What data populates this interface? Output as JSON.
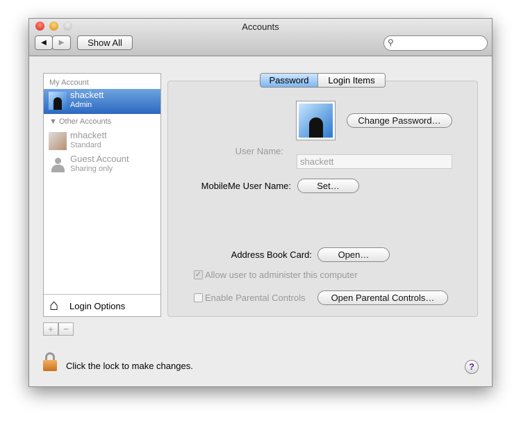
{
  "window": {
    "title": "Accounts"
  },
  "toolbar": {
    "show_all": "Show All",
    "back": "◀",
    "forward": "▶",
    "search_placeholder": ""
  },
  "sidebar": {
    "my_account_header": "My Account",
    "other_accounts_header": "Other Accounts",
    "accounts": [
      {
        "name": "shackett",
        "role": "Admin"
      },
      {
        "name": "mhackett",
        "role": "Standard"
      },
      {
        "name": "Guest Account",
        "role": "Sharing only"
      }
    ],
    "login_options": "Login Options",
    "add": "+",
    "remove": "−"
  },
  "tabs": [
    {
      "label": "Password",
      "selected": true
    },
    {
      "label": "Login Items",
      "selected": false
    }
  ],
  "password": {
    "change_password": "Change Password…",
    "user_name_label": "User Name:",
    "user_name_value": "shackett",
    "mobileme_label": "MobileMe User Name:",
    "set_button": "Set…",
    "address_book_label": "Address Book Card:",
    "open_button": "Open…",
    "allow_admin": "Allow user to administer this computer",
    "allow_admin_checked": true,
    "parental_controls": "Enable Parental Controls",
    "parental_checked": false,
    "open_parental": "Open Parental Controls…"
  },
  "footer": {
    "lock_text": "Click the lock to make changes.",
    "help": "?"
  }
}
